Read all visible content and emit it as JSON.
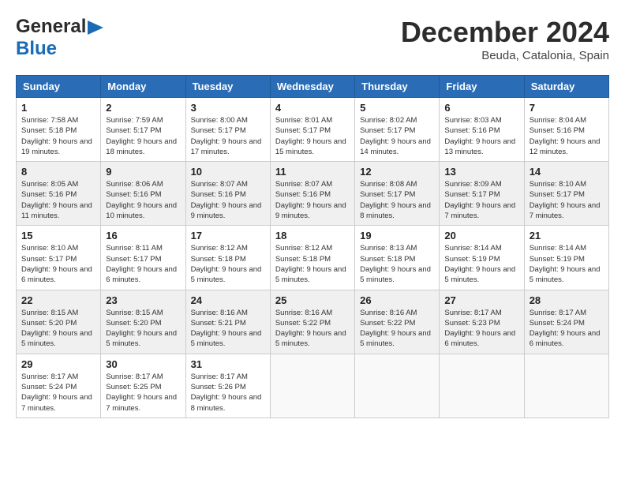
{
  "header": {
    "logo_general": "General",
    "logo_blue": "Blue",
    "month": "December 2024",
    "location": "Beuda, Catalonia, Spain"
  },
  "days_of_week": [
    "Sunday",
    "Monday",
    "Tuesday",
    "Wednesday",
    "Thursday",
    "Friday",
    "Saturday"
  ],
  "weeks": [
    [
      {
        "day": "1",
        "sunrise": "Sunrise: 7:58 AM",
        "sunset": "Sunset: 5:18 PM",
        "daylight": "Daylight: 9 hours and 19 minutes."
      },
      {
        "day": "2",
        "sunrise": "Sunrise: 7:59 AM",
        "sunset": "Sunset: 5:17 PM",
        "daylight": "Daylight: 9 hours and 18 minutes."
      },
      {
        "day": "3",
        "sunrise": "Sunrise: 8:00 AM",
        "sunset": "Sunset: 5:17 PM",
        "daylight": "Daylight: 9 hours and 17 minutes."
      },
      {
        "day": "4",
        "sunrise": "Sunrise: 8:01 AM",
        "sunset": "Sunset: 5:17 PM",
        "daylight": "Daylight: 9 hours and 15 minutes."
      },
      {
        "day": "5",
        "sunrise": "Sunrise: 8:02 AM",
        "sunset": "Sunset: 5:17 PM",
        "daylight": "Daylight: 9 hours and 14 minutes."
      },
      {
        "day": "6",
        "sunrise": "Sunrise: 8:03 AM",
        "sunset": "Sunset: 5:16 PM",
        "daylight": "Daylight: 9 hours and 13 minutes."
      },
      {
        "day": "7",
        "sunrise": "Sunrise: 8:04 AM",
        "sunset": "Sunset: 5:16 PM",
        "daylight": "Daylight: 9 hours and 12 minutes."
      }
    ],
    [
      {
        "day": "8",
        "sunrise": "Sunrise: 8:05 AM",
        "sunset": "Sunset: 5:16 PM",
        "daylight": "Daylight: 9 hours and 11 minutes."
      },
      {
        "day": "9",
        "sunrise": "Sunrise: 8:06 AM",
        "sunset": "Sunset: 5:16 PM",
        "daylight": "Daylight: 9 hours and 10 minutes."
      },
      {
        "day": "10",
        "sunrise": "Sunrise: 8:07 AM",
        "sunset": "Sunset: 5:16 PM",
        "daylight": "Daylight: 9 hours and 9 minutes."
      },
      {
        "day": "11",
        "sunrise": "Sunrise: 8:07 AM",
        "sunset": "Sunset: 5:16 PM",
        "daylight": "Daylight: 9 hours and 9 minutes."
      },
      {
        "day": "12",
        "sunrise": "Sunrise: 8:08 AM",
        "sunset": "Sunset: 5:17 PM",
        "daylight": "Daylight: 9 hours and 8 minutes."
      },
      {
        "day": "13",
        "sunrise": "Sunrise: 8:09 AM",
        "sunset": "Sunset: 5:17 PM",
        "daylight": "Daylight: 9 hours and 7 minutes."
      },
      {
        "day": "14",
        "sunrise": "Sunrise: 8:10 AM",
        "sunset": "Sunset: 5:17 PM",
        "daylight": "Daylight: 9 hours and 7 minutes."
      }
    ],
    [
      {
        "day": "15",
        "sunrise": "Sunrise: 8:10 AM",
        "sunset": "Sunset: 5:17 PM",
        "daylight": "Daylight: 9 hours and 6 minutes."
      },
      {
        "day": "16",
        "sunrise": "Sunrise: 8:11 AM",
        "sunset": "Sunset: 5:17 PM",
        "daylight": "Daylight: 9 hours and 6 minutes."
      },
      {
        "day": "17",
        "sunrise": "Sunrise: 8:12 AM",
        "sunset": "Sunset: 5:18 PM",
        "daylight": "Daylight: 9 hours and 5 minutes."
      },
      {
        "day": "18",
        "sunrise": "Sunrise: 8:12 AM",
        "sunset": "Sunset: 5:18 PM",
        "daylight": "Daylight: 9 hours and 5 minutes."
      },
      {
        "day": "19",
        "sunrise": "Sunrise: 8:13 AM",
        "sunset": "Sunset: 5:18 PM",
        "daylight": "Daylight: 9 hours and 5 minutes."
      },
      {
        "day": "20",
        "sunrise": "Sunrise: 8:14 AM",
        "sunset": "Sunset: 5:19 PM",
        "daylight": "Daylight: 9 hours and 5 minutes."
      },
      {
        "day": "21",
        "sunrise": "Sunrise: 8:14 AM",
        "sunset": "Sunset: 5:19 PM",
        "daylight": "Daylight: 9 hours and 5 minutes."
      }
    ],
    [
      {
        "day": "22",
        "sunrise": "Sunrise: 8:15 AM",
        "sunset": "Sunset: 5:20 PM",
        "daylight": "Daylight: 9 hours and 5 minutes."
      },
      {
        "day": "23",
        "sunrise": "Sunrise: 8:15 AM",
        "sunset": "Sunset: 5:20 PM",
        "daylight": "Daylight: 9 hours and 5 minutes."
      },
      {
        "day": "24",
        "sunrise": "Sunrise: 8:16 AM",
        "sunset": "Sunset: 5:21 PM",
        "daylight": "Daylight: 9 hours and 5 minutes."
      },
      {
        "day": "25",
        "sunrise": "Sunrise: 8:16 AM",
        "sunset": "Sunset: 5:22 PM",
        "daylight": "Daylight: 9 hours and 5 minutes."
      },
      {
        "day": "26",
        "sunrise": "Sunrise: 8:16 AM",
        "sunset": "Sunset: 5:22 PM",
        "daylight": "Daylight: 9 hours and 5 minutes."
      },
      {
        "day": "27",
        "sunrise": "Sunrise: 8:17 AM",
        "sunset": "Sunset: 5:23 PM",
        "daylight": "Daylight: 9 hours and 6 minutes."
      },
      {
        "day": "28",
        "sunrise": "Sunrise: 8:17 AM",
        "sunset": "Sunset: 5:24 PM",
        "daylight": "Daylight: 9 hours and 6 minutes."
      }
    ],
    [
      {
        "day": "29",
        "sunrise": "Sunrise: 8:17 AM",
        "sunset": "Sunset: 5:24 PM",
        "daylight": "Daylight: 9 hours and 7 minutes."
      },
      {
        "day": "30",
        "sunrise": "Sunrise: 8:17 AM",
        "sunset": "Sunset: 5:25 PM",
        "daylight": "Daylight: 9 hours and 7 minutes."
      },
      {
        "day": "31",
        "sunrise": "Sunrise: 8:17 AM",
        "sunset": "Sunset: 5:26 PM",
        "daylight": "Daylight: 9 hours and 8 minutes."
      },
      null,
      null,
      null,
      null
    ]
  ]
}
